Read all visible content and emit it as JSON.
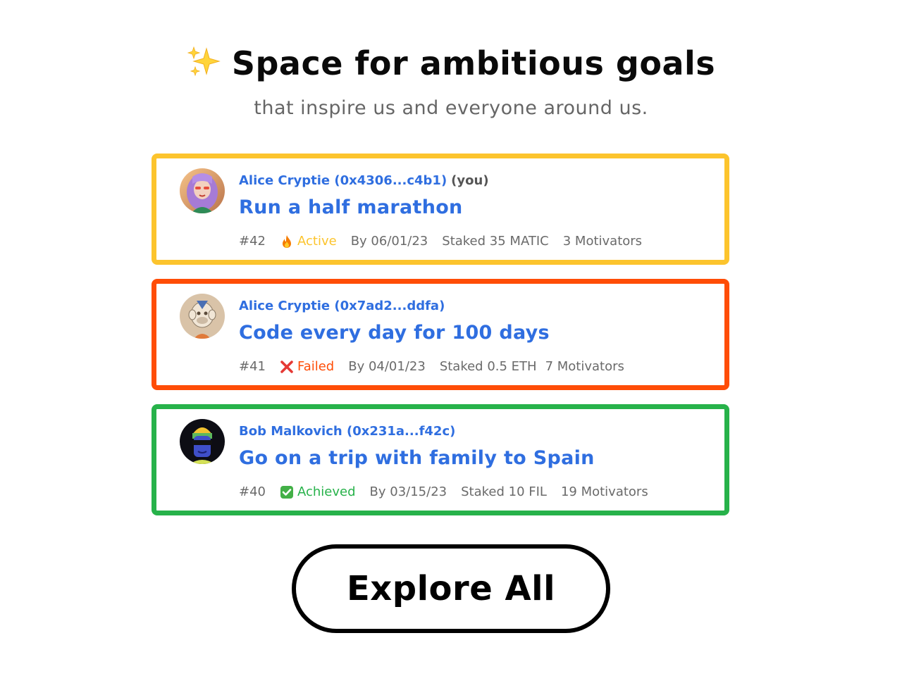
{
  "hero": {
    "icon": "sparkles-icon",
    "title": "Space for ambitious goals",
    "subtitle": "that inspire us and everyone around us."
  },
  "goals": [
    {
      "author": "Alice Cryptie (0x4306...c4b1)",
      "you_label": "(you)",
      "title": "Run a half marathon",
      "id": "#42",
      "status_icon": "fire-icon",
      "status": "Active",
      "deadline": "By 06/01/23",
      "stake": "Staked 35 MATIC",
      "motivators": "3 Motivators",
      "color": "#fcc42d"
    },
    {
      "author": "Alice Cryptie (0x7ad2...ddfa)",
      "title": "Code every day for 100 days",
      "id": "#41",
      "status_icon": "cross-mark-icon",
      "status": "Failed",
      "deadline": "By 04/01/23",
      "stake": "Staked 0.5 ETH",
      "motivators": "7 Motivators",
      "color": "#ff4d07"
    },
    {
      "author": "Bob Malkovich (0x231a...f42c)",
      "title": "Go on a trip with family to Spain",
      "id": "#40",
      "status_icon": "check-mark-icon",
      "status": "Achieved",
      "deadline": "By 03/15/23",
      "stake": "Staked 10 FIL",
      "motivators": "19 Motivators",
      "color": "#27b24a"
    }
  ],
  "explore_button": {
    "label": "Explore All"
  }
}
